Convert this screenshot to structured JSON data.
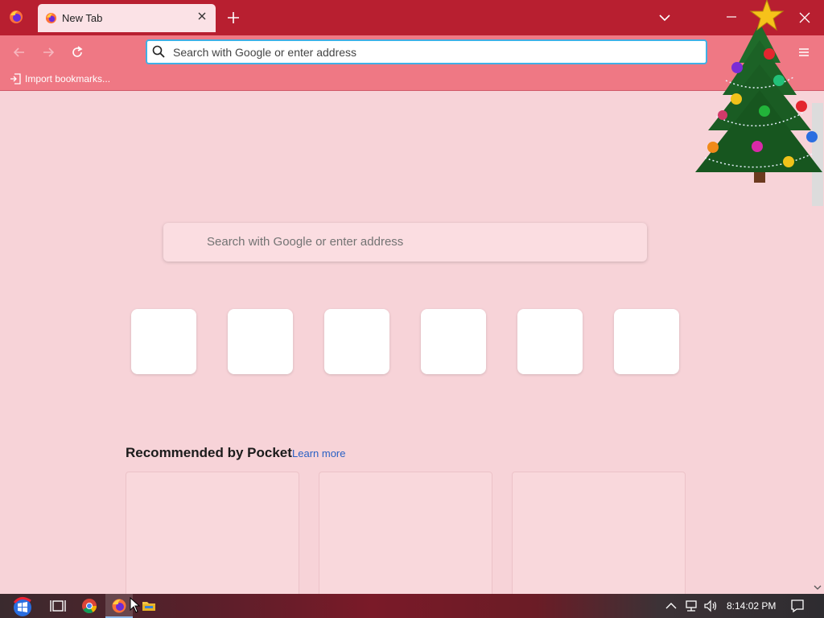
{
  "browser": {
    "tab": {
      "title": "New Tab"
    },
    "urlbar": {
      "placeholder": "Search with Google or enter address"
    },
    "bookmarks": {
      "import_label": "Import bookmarks..."
    }
  },
  "newtab": {
    "search_placeholder": "Search with Google or enter address",
    "top_sites_count": 6,
    "pocket": {
      "heading": "Recommended by Pocket",
      "learn_more": "Learn more",
      "cards_count": 3
    }
  },
  "taskbar": {
    "clock": "8:14:02 PM",
    "apps": [
      "start-icon",
      "task-view-icon",
      "chrome-icon",
      "firefox-icon",
      "file-explorer-icon"
    ]
  },
  "colors": {
    "tabstrip": "#b81f30",
    "toolbar": "#ef7884",
    "content_bg": "#f7d3d8",
    "urlbar_focus": "#3fb0e6",
    "link": "#2a61c4"
  }
}
